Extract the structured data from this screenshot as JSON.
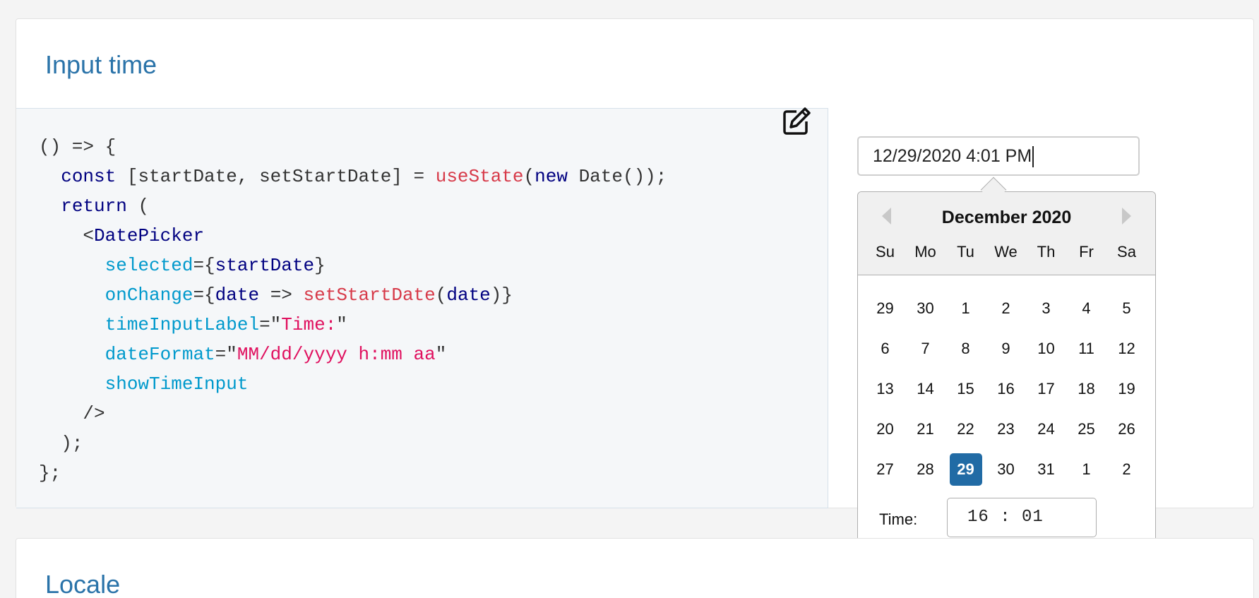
{
  "section1": {
    "title": "Input time"
  },
  "code": {
    "line1": "() => {",
    "line2_const": "const",
    "line2_mid": " [startDate, setStartDate] = ",
    "line2_fn": "useState",
    "line2_paren": "(",
    "line2_new": "new",
    "line2_end": " Date());",
    "line3_return": "return",
    "line3_end": " (",
    "line4_lt": "<",
    "line4_comp": "DatePicker",
    "line5_attr": "selected",
    "line5_eq": "={",
    "line5_val": "startDate",
    "line5_end": "}",
    "line6_attr": "onChange",
    "line6_eq": "={",
    "line6_arg": "date",
    "line6_arrow": " => ",
    "line6_fn": "setStartDate",
    "line6_open": "(",
    "line6_arg2": "date",
    "line6_end": ")}",
    "line7_attr": "timeInputLabel",
    "line7_eq": "=\"",
    "line7_str": "Time:",
    "line7_end": "\"",
    "line8_attr": "dateFormat",
    "line8_eq": "=\"",
    "line8_str": "MM/dd/yyyy h:mm aa",
    "line8_end": "\"",
    "line9_attr": "showTimeInput",
    "line10": "/>",
    "line11": ");",
    "line12": "};"
  },
  "edit_icon": "edit-icon",
  "date_input": {
    "value": "12/29/2020 4:01 PM"
  },
  "calendar": {
    "month": "December 2020",
    "weekdays": [
      "Su",
      "Mo",
      "Tu",
      "We",
      "Th",
      "Fr",
      "Sa"
    ],
    "weeks": [
      [
        "29",
        "30",
        "1",
        "2",
        "3",
        "4",
        "5"
      ],
      [
        "6",
        "7",
        "8",
        "9",
        "10",
        "11",
        "12"
      ],
      [
        "13",
        "14",
        "15",
        "16",
        "17",
        "18",
        "19"
      ],
      [
        "20",
        "21",
        "22",
        "23",
        "24",
        "25",
        "26"
      ],
      [
        "27",
        "28",
        "29",
        "30",
        "31",
        "1",
        "2"
      ]
    ],
    "selected_day": "29",
    "time_label": "Time:",
    "time_value": "16 : 01",
    "accent_color": "#216ba5"
  },
  "section2": {
    "title": "Locale"
  }
}
